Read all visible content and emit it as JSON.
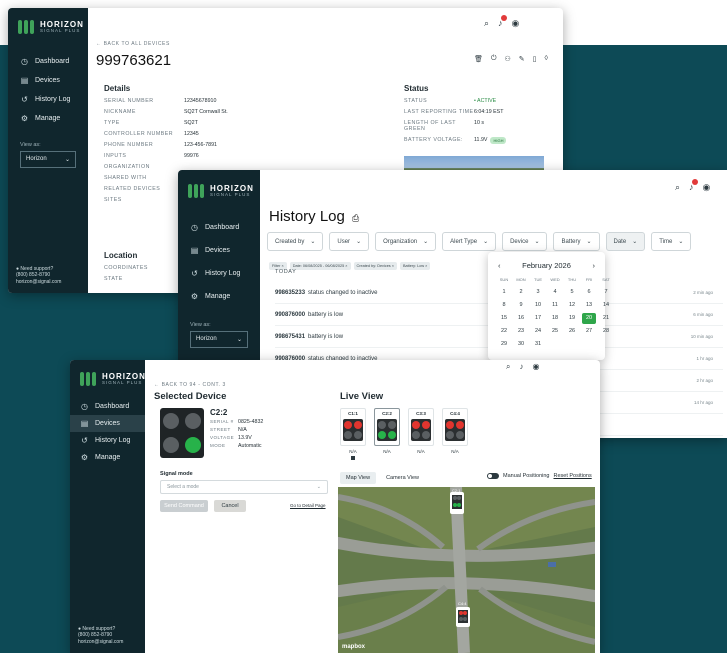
{
  "brand": {
    "line1": "HORIZON",
    "line2": "SIGNAL PLUS"
  },
  "nav": [
    {
      "label": "Dashboard",
      "icon": "dashboard-icon"
    },
    {
      "label": "Devices",
      "icon": "devices-icon"
    },
    {
      "label": "History Log",
      "icon": "history-icon"
    },
    {
      "label": "Manage",
      "icon": "gear-icon"
    }
  ],
  "view_as": {
    "label": "View as:",
    "value": "Horizon"
  },
  "support": {
    "label": "Need support?",
    "phone": "(800) 852-8790",
    "email": "horizon@signal.com"
  },
  "device_window": {
    "back": "← BACK TO ALL DEVICES",
    "title": "999763621",
    "details_title": "Details",
    "details": [
      {
        "k": "SERIAL NUMBER",
        "v": "12345678910"
      },
      {
        "k": "NICKNAME",
        "v": "SQ2T Cornwall St."
      },
      {
        "k": "TYPE",
        "v": "SQ2T"
      },
      {
        "k": "CONTROLLER NUMBER",
        "v": "12345"
      },
      {
        "k": "PHONE NUMBER",
        "v": "123-456-7891"
      },
      {
        "k": "INPUTS",
        "v": "99976"
      },
      {
        "k": "ORGANIZATION",
        "v": ""
      },
      {
        "k": "SHARED WITH",
        "v": ""
      },
      {
        "k": "RELATED DEVICES",
        "v": ""
      },
      {
        "k": "SITES",
        "v": ""
      }
    ],
    "location_title": "Location",
    "location": [
      {
        "k": "COORDINATES",
        "v": ""
      },
      {
        "k": "STATE",
        "v": ""
      }
    ],
    "status_title": "Status",
    "status": [
      {
        "k": "STATUS",
        "v": "• ACTIVE"
      },
      {
        "k": "LAST REPORTING TIME",
        "v": "6:04:19 EST"
      },
      {
        "k": "LENGTH OF LAST GREEN",
        "v": "10 s"
      },
      {
        "k": "BATTERY VOLTAGE:",
        "v": "11.9V"
      }
    ],
    "battery_badge": "HIGH"
  },
  "history_window": {
    "title": "History Log",
    "filters": [
      "Created by",
      "User",
      "Organization",
      "Alert Type",
      "Device",
      "Battery",
      "Date",
      "Time"
    ],
    "tags": [
      "Filter ×",
      "Date: 06/08/2025 - 06/08/2025 ×",
      "Created by: Devices ×",
      "Battery: Low ×"
    ],
    "today": "TODAY",
    "rows": [
      {
        "id": "998635233",
        "text": "status changed to inactive",
        "ago": "2 min ago"
      },
      {
        "id": "990876000",
        "text": "battery is low",
        "ago": "6 min ago"
      },
      {
        "id": "998675431",
        "text": "battery is low",
        "ago": "10 min ago"
      },
      {
        "id": "990876000",
        "text": "status changed to inactive",
        "ago": "1 hr ago"
      },
      {
        "id": "",
        "text": "",
        "ago": "2 hr ago"
      },
      {
        "id": "",
        "text": "",
        "ago": "14 hr ago"
      },
      {
        "id": "",
        "text": "",
        "ago": ""
      },
      {
        "id": "",
        "text": "",
        "ago": "1 day ago"
      }
    ],
    "calendar": {
      "prev": "‹",
      "next": "›",
      "month": "February 2026",
      "days": [
        "SUN",
        "MON",
        "TUE",
        "WED",
        "THU",
        "FRI",
        "SAT"
      ],
      "dates": [
        "",
        "",
        "",
        "",
        "",
        "",
        "",
        "1",
        "2",
        "3",
        "4",
        "5",
        "6",
        "7",
        "8",
        "9",
        "10",
        "11",
        "12",
        "13",
        "14",
        "15",
        "16",
        "17",
        "18",
        "19",
        "20",
        "21",
        "22",
        "23",
        "24",
        "25",
        "26",
        "27",
        "28",
        "29",
        "30",
        "31",
        "",
        "",
        "",
        ""
      ],
      "today_index": 26
    }
  },
  "live_window": {
    "back": "← BACK TO 94 - CONT. 3",
    "selected_title": "Selected Device",
    "device_name": "C2:2",
    "device_props": [
      {
        "k": "SERIAL #",
        "v": "0825-4832"
      },
      {
        "k": "STREET",
        "v": "N/A"
      },
      {
        "k": "VOLTAGE",
        "v": "13.9V"
      },
      {
        "k": "MODE",
        "v": "Automatic"
      }
    ],
    "signal_mode_label": "Signal mode",
    "signal_mode_placeholder": "Select a mode",
    "send_label": "Send Command",
    "cancel_label": "Cancel",
    "detail_link": "Go to Detail Page",
    "live_title": "Live View",
    "signals": [
      {
        "name": "C1:1",
        "na": "N/A"
      },
      {
        "name": "C2:2",
        "na": "N/A"
      },
      {
        "name": "C3:3",
        "na": "N/A"
      },
      {
        "name": "C4:4",
        "na": "N/A"
      }
    ],
    "map_tab": "Map View",
    "camera_tab": "Camera View",
    "manual_label": "Manual Positioning",
    "reset_label": "Reset Positions",
    "map_signal_a": "C2:1",
    "map_signal_b": "C4:4",
    "mapbox": "mapbox",
    "colors": {
      "red": "#e1352f",
      "green": "#27b24a",
      "off": "#5a5f62"
    }
  }
}
